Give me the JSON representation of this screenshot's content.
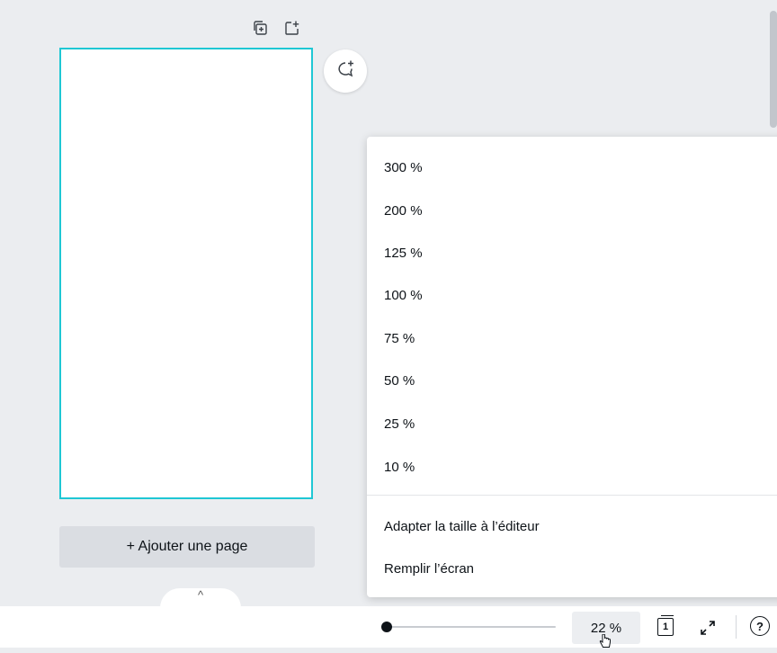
{
  "canvas": {
    "add_page_label": "+ Ajouter une page",
    "pages_tab_label": "^"
  },
  "icons": {
    "duplicate_page": "duplicate-page-icon",
    "add_page": "add-page-icon",
    "comment": "add-comment-icon",
    "fullscreen": "fullscreen-icon",
    "help": "help-icon"
  },
  "footer": {
    "zoom_label": "22 %",
    "zoom_slider_value": 22,
    "pages_count": "1",
    "help_label": "?"
  },
  "zoom_menu": {
    "options": [
      "300 %",
      "200 %",
      "125 %",
      "100 %",
      "75 %",
      "50 %",
      "25 %",
      "10 %"
    ],
    "fit_label": "Adapter la taille à l’éditeur",
    "fill_label": "Remplir l’écran"
  },
  "colors": {
    "selection_outline": "#1fc7d4",
    "canvas_bg": "#ebedf0"
  }
}
